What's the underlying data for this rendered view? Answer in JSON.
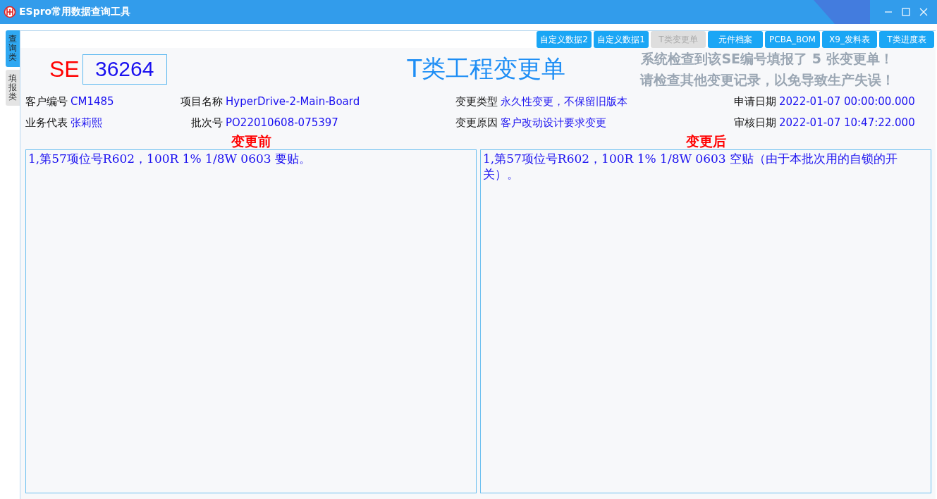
{
  "window": {
    "title": "ESpro常用数据查询工具"
  },
  "side_tabs": [
    {
      "label": "查询类",
      "selected": true
    },
    {
      "label": "填报类",
      "selected": false
    }
  ],
  "toolbar_buttons": [
    {
      "label": "自定义数据2",
      "disabled": false
    },
    {
      "label": "自定义数据1",
      "disabled": false
    },
    {
      "label": "T类变更单",
      "disabled": true
    },
    {
      "label": "元件档案",
      "disabled": false
    },
    {
      "label": "PCBA_BOM",
      "disabled": false
    },
    {
      "label": "X9_发料表",
      "disabled": false
    },
    {
      "label": "T类进度表",
      "disabled": false
    }
  ],
  "se_prefix": "SE",
  "se_number": "36264",
  "form_title": "T类工程变更单",
  "warning": [
    "系统检查到该SE编号填报了 5 张变更单！",
    "请检查其他变更记录，以免导致生产失误！"
  ],
  "fields": [
    {
      "label": "客户编号",
      "value": "CM1485"
    },
    {
      "label": "项目名称",
      "value": "HyperDrive-2-Main-Board"
    },
    {
      "label": "变更类型",
      "value": "永久性变更，不保留旧版本"
    },
    {
      "label": "申请日期",
      "value": "2022-01-07 00:00:00.000"
    },
    {
      "label": "业务代表",
      "value": "张莉熙"
    },
    {
      "label": "批次号",
      "value": "PO22010608-075397"
    },
    {
      "label": "变更原因",
      "value": "客户改动设计要求变更"
    },
    {
      "label": "审核日期",
      "value": "2022-01-07 10:47:22.000"
    }
  ],
  "panels": [
    {
      "heading": "变更前",
      "text": "1,第57项位号R602，100R 1% 1/8W 0603 要贴。"
    },
    {
      "heading": "变更后",
      "text": "1,第57项位号R602，100R 1% 1/8W 0603 空贴（由于本批次用的自锁的开关）。"
    }
  ]
}
